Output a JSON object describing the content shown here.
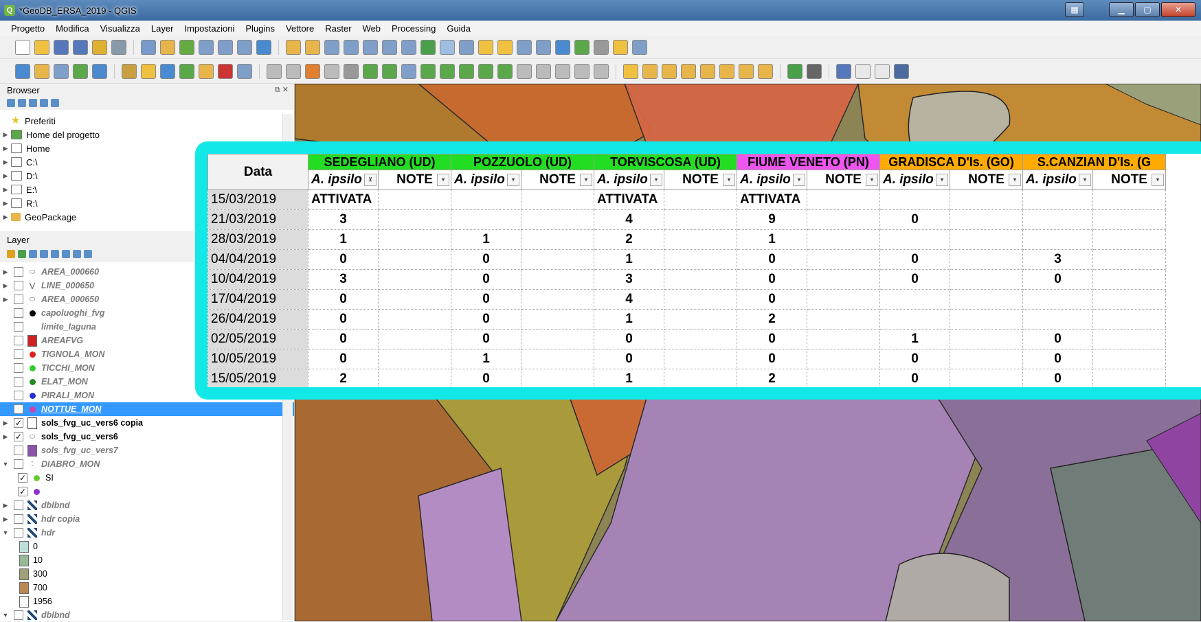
{
  "window": {
    "title": "*GeoDB_ERSA_2019 - QGIS"
  },
  "menu": [
    "Progetto",
    "Modifica",
    "Visualizza",
    "Layer",
    "Impostazioni",
    "Plugins",
    "Vettore",
    "Raster",
    "Web",
    "Processing",
    "Guida"
  ],
  "browser": {
    "title": "Browser",
    "items": [
      {
        "label": "Preferiti",
        "icon": "star-icon"
      },
      {
        "label": "Home del progetto",
        "icon": "project-home-icon"
      },
      {
        "label": "Home",
        "icon": "home-icon"
      },
      {
        "label": "C:\\",
        "icon": "folder-icon"
      },
      {
        "label": "D:\\",
        "icon": "folder-icon"
      },
      {
        "label": "E:\\",
        "icon": "folder-icon"
      },
      {
        "label": "R:\\",
        "icon": "folder-icon"
      },
      {
        "label": "GeoPackage",
        "icon": "geopackage-icon"
      }
    ]
  },
  "layers": {
    "title": "Layer",
    "items": [
      {
        "label": "AREA_000660",
        "sym": "polygon",
        "style": "italic",
        "exp": true
      },
      {
        "label": "LINE_000650",
        "sym": "line",
        "style": "italic",
        "exp": true
      },
      {
        "label": "AREA_000650",
        "sym": "polygon",
        "style": "italic",
        "exp": true
      },
      {
        "label": "capoluoghi_fvg",
        "sym": "dot",
        "color": "#000000",
        "style": "italic"
      },
      {
        "label": "limite_laguna",
        "sym": "none",
        "style": "italic"
      },
      {
        "label": "AREAFVG",
        "sym": "square",
        "color": "#cc2222",
        "style": "italic"
      },
      {
        "label": "TIGNOLA_MON",
        "sym": "dot",
        "color": "#dd2222",
        "style": "italic"
      },
      {
        "label": "TICCHI_MON",
        "sym": "dot",
        "color": "#33cc33",
        "style": "italic"
      },
      {
        "label": "ELAT_MON",
        "sym": "dot",
        "color": "#228822",
        "style": "italic"
      },
      {
        "label": "PIRALI_MON",
        "sym": "dot",
        "color": "#2233cc",
        "style": "italic"
      },
      {
        "label": "NOTTUE_MON",
        "sym": "dot",
        "color": "#cc44aa",
        "style": "selected",
        "checked": true
      },
      {
        "label": "sols_fvg_uc_vers6  copia",
        "sym": "square-empty",
        "style": "bold",
        "checked": true,
        "exp": true
      },
      {
        "label": "sols_fvg_uc_vers6",
        "sym": "polygon",
        "style": "bold",
        "checked": true,
        "exp": true
      },
      {
        "label": "sols_fvg_uc_vers7",
        "sym": "square",
        "color": "#8855aa",
        "style": "italic"
      },
      {
        "label": "DIABRO_MON",
        "sym": "points",
        "style": "italic",
        "open": true
      },
      {
        "label": "SI",
        "sym": "dot",
        "color": "#66cc33",
        "indent": true,
        "checked": true
      },
      {
        "label": "",
        "sym": "dot",
        "color": "#8833cc",
        "indent": true,
        "checked": true
      },
      {
        "label": "dblbnd",
        "sym": "raster",
        "style": "italic",
        "exp": true
      },
      {
        "label": "hdr  copia",
        "sym": "raster",
        "style": "italic",
        "exp": true
      },
      {
        "label": "hdr",
        "sym": "raster",
        "style": "italic",
        "open": true
      },
      {
        "label": "0",
        "sym": "legend",
        "color": "#bfe0d8",
        "indent": true,
        "nocheck": true
      },
      {
        "label": "10",
        "sym": "legend",
        "color": "#98b898",
        "indent": true,
        "nocheck": true
      },
      {
        "label": "300",
        "sym": "legend",
        "color": "#a0a07a",
        "indent": true,
        "nocheck": true
      },
      {
        "label": "700",
        "sym": "legend",
        "color": "#b88850",
        "indent": true,
        "nocheck": true
      },
      {
        "label": "1956",
        "sym": "legend",
        "color": "#f7f7f7",
        "indent": true,
        "nocheck": true
      },
      {
        "label": "dblbnd",
        "sym": "raster",
        "style": "italic",
        "open": true
      }
    ]
  },
  "table": {
    "date_header": "Data",
    "groups": [
      {
        "label": "SEDEGLIANO (UD)",
        "color": "#22dd22"
      },
      {
        "label": "POZZUOLO (UD)",
        "color": "#22dd22"
      },
      {
        "label": "TORVISCOSA (UD)",
        "color": "#22dd22"
      },
      {
        "label": "FIUME VENETO (PN)",
        "color": "#ee55ee"
      },
      {
        "label": "GRADISCA D'Is. (GO)",
        "color": "#ffaa00"
      },
      {
        "label": "S.CANZIAN D'Is. (G",
        "color": "#ffaa00"
      }
    ],
    "sub_a": "A. ipsilo",
    "sub_note": "NOTE",
    "last_note": "NOTE",
    "rows": [
      {
        "date": "15/03/2019",
        "v": [
          "ATTIVATA",
          "",
          "ATTIVATA",
          "ATTIVATA",
          "",
          ""
        ]
      },
      {
        "date": "21/03/2019",
        "v": [
          "3",
          "",
          "4",
          "9",
          "0",
          ""
        ]
      },
      {
        "date": "28/03/2019",
        "v": [
          "1",
          "1",
          "2",
          "1",
          "",
          ""
        ]
      },
      {
        "date": "04/04/2019",
        "v": [
          "0",
          "0",
          "1",
          "0",
          "0",
          "3"
        ]
      },
      {
        "date": "10/04/2019",
        "v": [
          "3",
          "0",
          "3",
          "0",
          "0",
          "0"
        ]
      },
      {
        "date": "17/04/2019",
        "v": [
          "0",
          "0",
          "4",
          "0",
          "",
          ""
        ]
      },
      {
        "date": "26/04/2019",
        "v": [
          "0",
          "0",
          "1",
          "2",
          "",
          ""
        ]
      },
      {
        "date": "02/05/2019",
        "v": [
          "0",
          "0",
          "0",
          "0",
          "1",
          "0"
        ]
      },
      {
        "date": "10/05/2019",
        "v": [
          "0",
          "1",
          "0",
          "0",
          "0",
          "0"
        ]
      },
      {
        "date": "15/05/2019",
        "v": [
          "2",
          "0",
          "1",
          "2",
          "0",
          "0"
        ]
      }
    ]
  }
}
